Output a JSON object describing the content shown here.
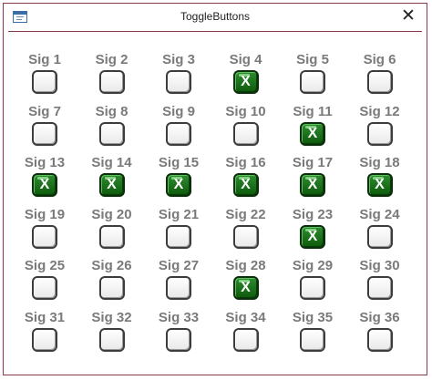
{
  "window": {
    "title": "ToggleButtons",
    "close_label": "✕"
  },
  "toggles": [
    {
      "label": "Sig 1",
      "checked": false
    },
    {
      "label": "Sig 2",
      "checked": false
    },
    {
      "label": "Sig 3",
      "checked": false
    },
    {
      "label": "Sig 4",
      "checked": true
    },
    {
      "label": "Sig 5",
      "checked": false
    },
    {
      "label": "Sig 6",
      "checked": false
    },
    {
      "label": "Sig 7",
      "checked": false
    },
    {
      "label": "Sig 8",
      "checked": false
    },
    {
      "label": "Sig 9",
      "checked": false
    },
    {
      "label": "Sig 10",
      "checked": false
    },
    {
      "label": "Sig 11",
      "checked": true
    },
    {
      "label": "Sig 12",
      "checked": false
    },
    {
      "label": "Sig 13",
      "checked": true
    },
    {
      "label": "Sig 14",
      "checked": true
    },
    {
      "label": "Sig 15",
      "checked": true
    },
    {
      "label": "Sig 16",
      "checked": true
    },
    {
      "label": "Sig 17",
      "checked": true
    },
    {
      "label": "Sig 18",
      "checked": true
    },
    {
      "label": "Sig 19",
      "checked": false
    },
    {
      "label": "Sig 20",
      "checked": false
    },
    {
      "label": "Sig 21",
      "checked": false
    },
    {
      "label": "Sig 22",
      "checked": false
    },
    {
      "label": "Sig 23",
      "checked": true
    },
    {
      "label": "Sig 24",
      "checked": false
    },
    {
      "label": "Sig 25",
      "checked": false
    },
    {
      "label": "Sig 26",
      "checked": false
    },
    {
      "label": "Sig 27",
      "checked": false
    },
    {
      "label": "Sig 28",
      "checked": true
    },
    {
      "label": "Sig 29",
      "checked": false
    },
    {
      "label": "Sig 30",
      "checked": false
    },
    {
      "label": "Sig 31",
      "checked": false
    },
    {
      "label": "Sig 32",
      "checked": false
    },
    {
      "label": "Sig 33",
      "checked": false
    },
    {
      "label": "Sig 34",
      "checked": false
    },
    {
      "label": "Sig 35",
      "checked": false
    },
    {
      "label": "Sig 36",
      "checked": false
    }
  ],
  "checked_mark": "X",
  "colors": {
    "checked_fill": "#1f7a1f",
    "frame_border": "#8c3a4a",
    "label_text": "#7a7a7a"
  }
}
